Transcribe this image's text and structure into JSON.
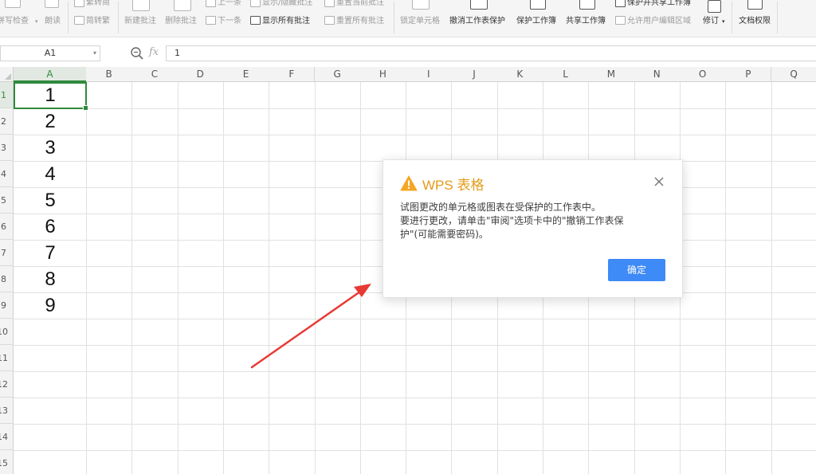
{
  "ribbon": {
    "proofread_label": "拼写检查",
    "read_aloud_label": "朗读",
    "trad_to_simp_label": "繁转简",
    "simp_to_trad_label": "简转繁",
    "new_comment_label": "新建批注",
    "delete_comment_label": "删除批注",
    "prev_label": "上一条",
    "next_label": "下一条",
    "show_hide_comment_label": "显示/隐藏批注",
    "show_all_comments_label": "显示所有批注",
    "reset_current_comment_label": "重置当前批注",
    "reset_all_comments_label": "重置所有批注",
    "lock_cell_label": "锁定单元格",
    "unprotect_sheet_label": "撤消工作表保护",
    "protect_workbook_label": "保护工作簿",
    "share_workbook_label": "共享工作簿",
    "protect_share_workbook_label": "保护并共享工作簿",
    "allow_edit_ranges_label": "允许用户编辑区域",
    "track_changes_label": "修订",
    "doc_permissions_label": "文档权限"
  },
  "formula_bar": {
    "name_box": "A1",
    "fx_label": "fx",
    "content": "1"
  },
  "sheet": {
    "columns": [
      "A",
      "B",
      "C",
      "D",
      "E",
      "F",
      "G",
      "H",
      "I",
      "J",
      "K",
      "L",
      "M",
      "N",
      "O",
      "P",
      "Q"
    ],
    "rows": [
      "1",
      "2",
      "3",
      "4",
      "5",
      "6",
      "7",
      "8",
      "9",
      "10",
      "11",
      "12",
      "13",
      "14",
      "15"
    ],
    "cells_A": [
      "1",
      "2",
      "3",
      "4",
      "5",
      "6",
      "7",
      "8",
      "9"
    ],
    "selected_cell": "A1"
  },
  "dialog": {
    "title": "WPS 表格",
    "message_lines": [
      "试图更改的单元格或图表在受保护的工作表中。",
      "要进行更改，请单击\"审阅\"选项卡中的\"撤销工作表保",
      "护\"(可能需要密码)。"
    ],
    "ok_label": "确定"
  },
  "colors": {
    "accent_green": "#2f8a3c",
    "dialog_title": "#e39b1a",
    "ok_button": "#3e8af6",
    "annotation_arrow": "#e83a35"
  }
}
